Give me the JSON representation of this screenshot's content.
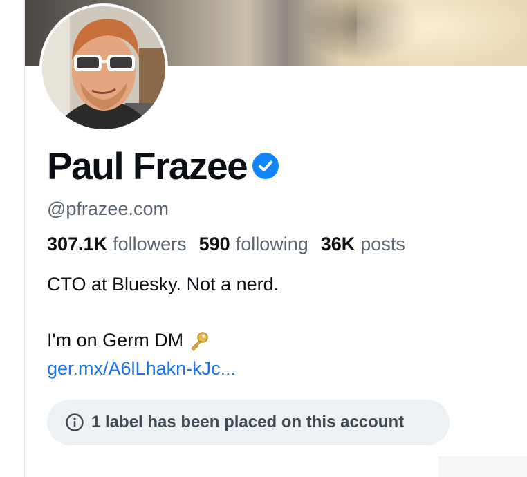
{
  "profile": {
    "display_name": "Paul Frazee",
    "handle": "@pfrazee.com",
    "verified_icon": "verified-check-icon",
    "stats": {
      "followers_count": "307.1K",
      "followers_label": "followers",
      "following_count": "590",
      "following_label": "following",
      "posts_count": "36K",
      "posts_label": "posts"
    },
    "bio": {
      "line1": "CTO at Bluesky. Not a nerd.",
      "line2": "I'm on Germ DM",
      "key_icon": "key-icon",
      "link_text": "ger.mx/A6lLhakn-kJc..."
    },
    "label_notice": "1 label has been placed on this account"
  },
  "colors": {
    "text_primary": "#0b0f14",
    "text_secondary": "#5b6672",
    "link": "#1a73e8",
    "verified": "#1185fe",
    "pill_bg": "#eef1f4"
  }
}
